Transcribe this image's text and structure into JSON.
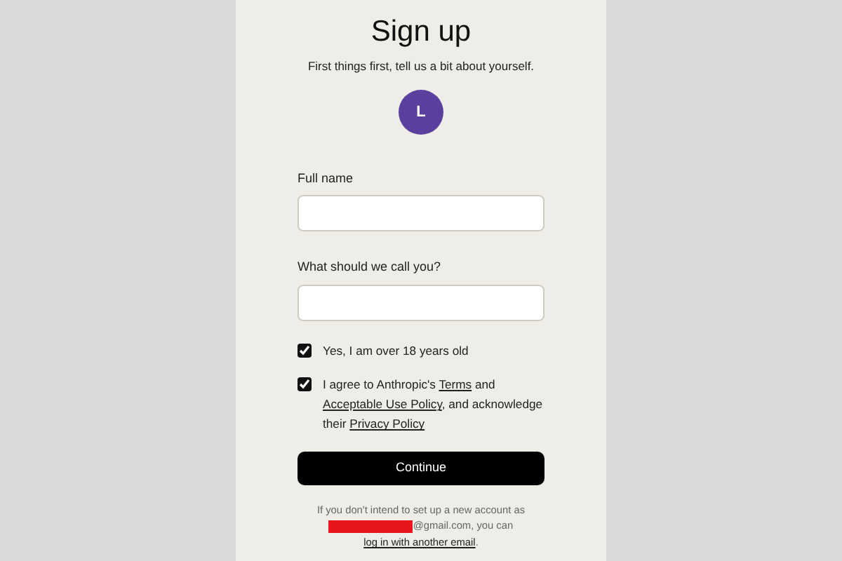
{
  "title": "Sign up",
  "subtitle": "First things first, tell us a bit about yourself.",
  "avatar": {
    "initial": "L"
  },
  "fields": [
    {
      "label": "Full name"
    },
    {
      "label": "What should we call you?"
    }
  ],
  "checks": [
    {
      "parts": [
        {
          "text": "Yes, I am over 18 years old",
          "kind": "text"
        }
      ],
      "checked": true
    },
    {
      "parts": [
        {
          "text": "I agree to Anthropic's ",
          "kind": "text"
        },
        {
          "text": "Terms",
          "kind": "link"
        },
        {
          "text": " and ",
          "kind": "text"
        },
        {
          "text": "Acceptable Use Policy",
          "kind": "link"
        },
        {
          "text": ", and acknowledge their ",
          "kind": "text"
        },
        {
          "text": "Privacy Policy",
          "kind": "link"
        }
      ],
      "checked": true
    }
  ],
  "button": "Continue",
  "footer": {
    "parts": [
      {
        "text": "If you don't intend to set up a new account as ",
        "kind": "text"
      },
      {
        "kind": "redaction"
      },
      {
        "text": "@gmail.com, you can ",
        "kind": "text"
      },
      {
        "text": "log in with another email",
        "kind": "link"
      },
      {
        "text": ".",
        "kind": "text"
      }
    ]
  }
}
